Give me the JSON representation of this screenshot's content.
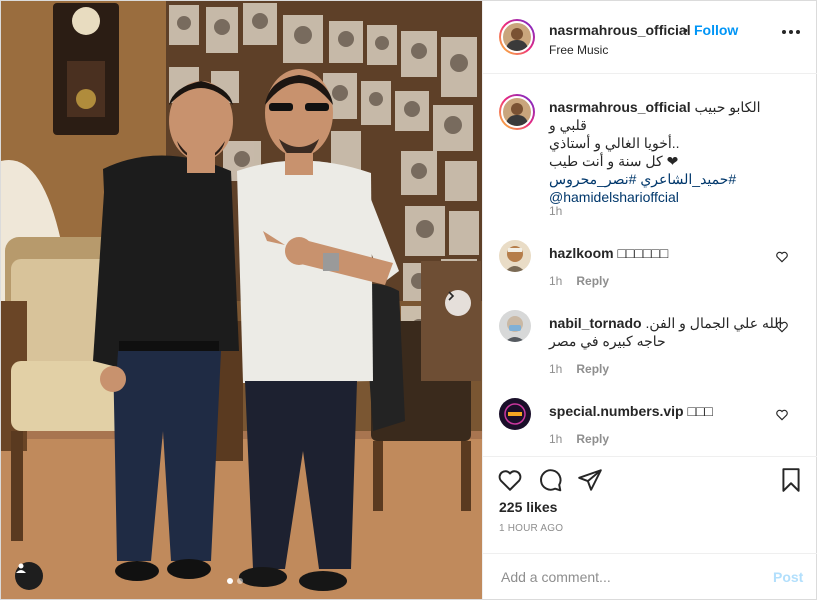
{
  "post": {
    "username": "nasrmahrous_official",
    "separator": "•",
    "follow_label": "Follow",
    "subtitle": "Free Music",
    "more_icon": "more-horizontal-icon"
  },
  "caption": {
    "username": "nasrmahrous_official",
    "line1": "الكابو حبيب قلبي و",
    "line2": "..أخويا الغالي و أستاذي",
    "line3": "❤ كل سنة و أنت طيب",
    "hashtags": "#حميد_الشاعري #نصر_محروس",
    "mention": "@hamidelsharioffcial",
    "time": "1h"
  },
  "comments": [
    {
      "username": "hazlkoom",
      "text": "□□□□□□",
      "time": "1h",
      "reply_label": "Reply"
    },
    {
      "username": "nabil_tornado",
      "text": "الله علي الجمال و الفن.",
      "text2": "حاجه كبيره في مصر",
      "time": "1h",
      "reply_label": "Reply"
    },
    {
      "username": "special.numbers.vip",
      "text": "□□□",
      "time": "1h",
      "reply_label": "Reply"
    }
  ],
  "actions": {
    "likes": "225 likes",
    "time_ago": "1 HOUR AGO",
    "comment_placeholder": "Add a comment...",
    "post_label": "Post"
  },
  "carousel": {
    "slide_count": 2,
    "active_index": 0
  },
  "colors": {
    "accent": "#0095f6",
    "text": "#262626",
    "muted": "#8e8e8e",
    "link": "#00376b",
    "post_disabled": "#b2dffc"
  }
}
